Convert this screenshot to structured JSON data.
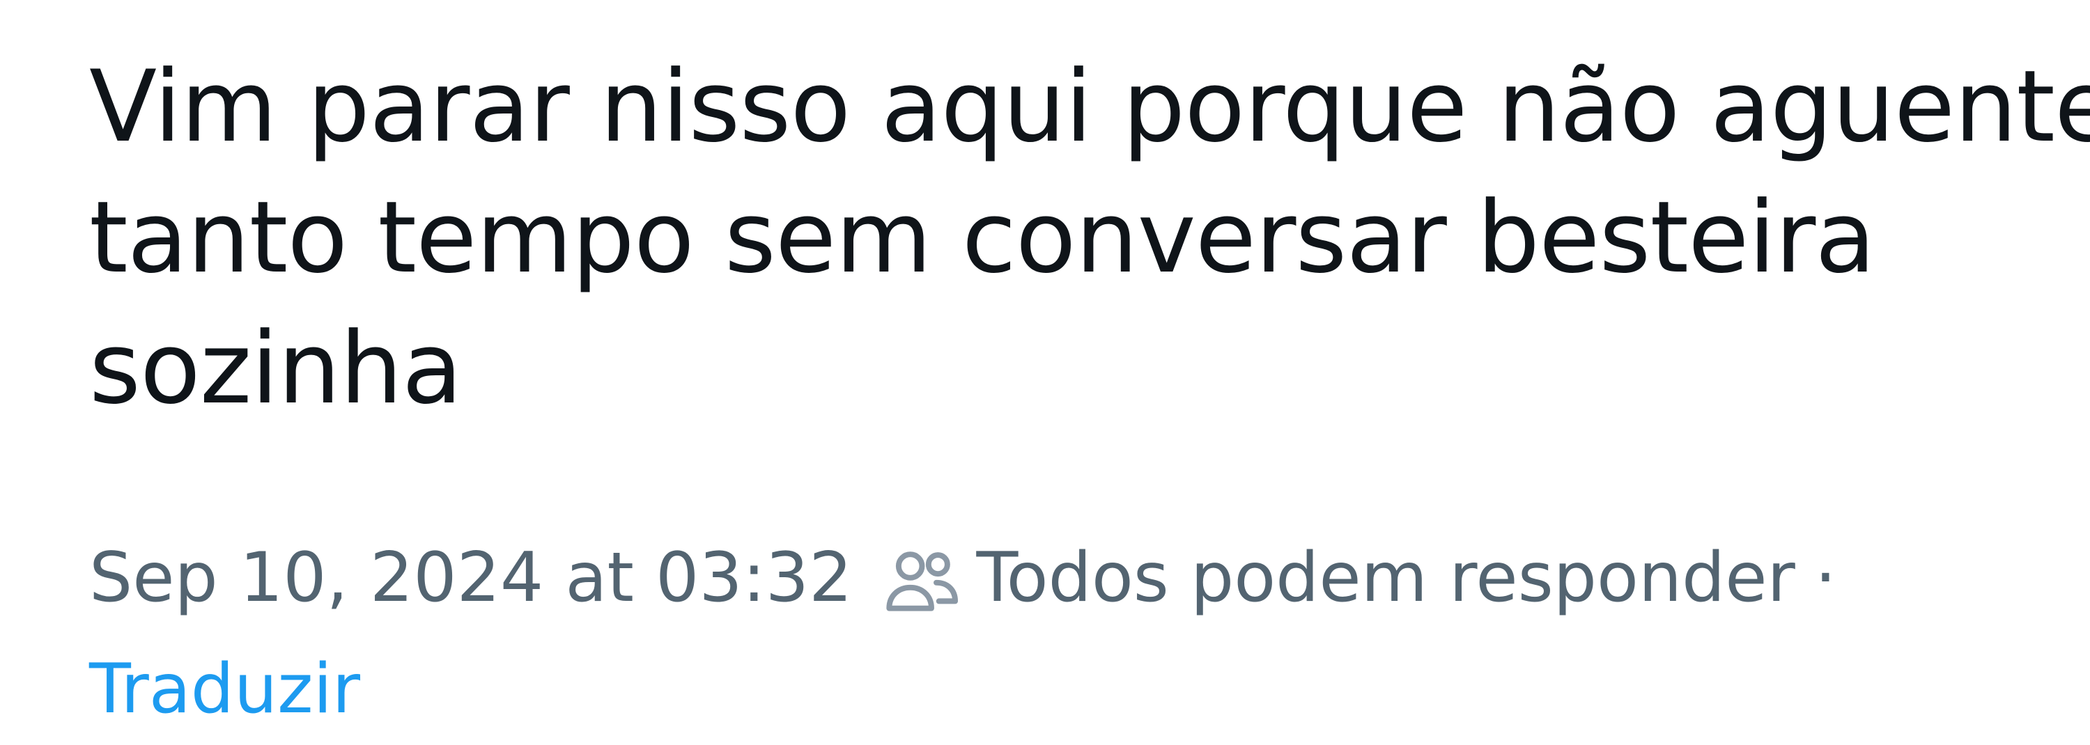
{
  "post": {
    "text_lines": [
      "Vim parar nisso aqui porque não aguentei",
      "tanto tempo sem conversar besteira",
      "sozinha"
    ],
    "timestamp": "Sep 10, 2024 at 03:32",
    "reply_setting_icon": "people-icon",
    "reply_setting": "Todos podem responder",
    "separator": "·",
    "translate_label": "Traduzir"
  },
  "colors": {
    "text_primary": "#0f1419",
    "text_secondary": "#536471",
    "link": "#1d9bf0",
    "background": "#ffffff"
  }
}
